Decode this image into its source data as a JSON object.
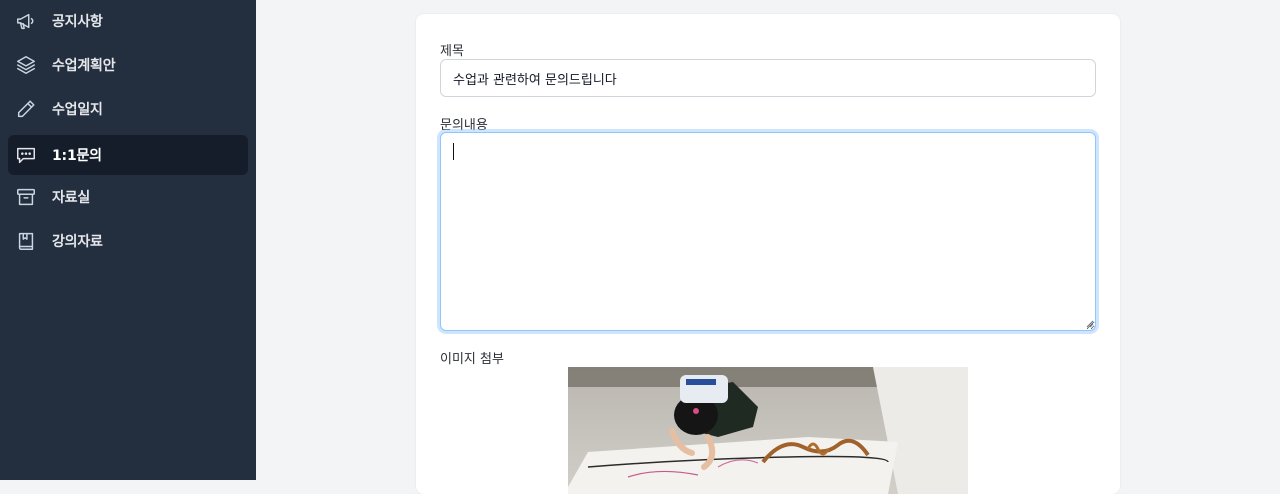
{
  "sidebar": {
    "items": [
      {
        "label": "공지사항",
        "icon": "megaphone-icon",
        "active": false
      },
      {
        "label": "수업계획안",
        "icon": "layers-icon",
        "active": false
      },
      {
        "label": "수업일지",
        "icon": "pencil-icon",
        "active": false
      },
      {
        "label": "1:1문의",
        "icon": "chat-icon",
        "active": true
      },
      {
        "label": "자료실",
        "icon": "archive-box-icon",
        "active": false
      },
      {
        "label": "강의자료",
        "icon": "book-icon",
        "active": false
      }
    ],
    "colors": {
      "background": "#232e3f",
      "active_background": "#151d2b"
    }
  },
  "form": {
    "title_label": "제목",
    "title_value": "수업과 관련하여 문의드립니다",
    "content_label": "문의내용",
    "content_value": "",
    "image_label": "이미지 첨부",
    "attachment_icon": "attached-photo"
  }
}
